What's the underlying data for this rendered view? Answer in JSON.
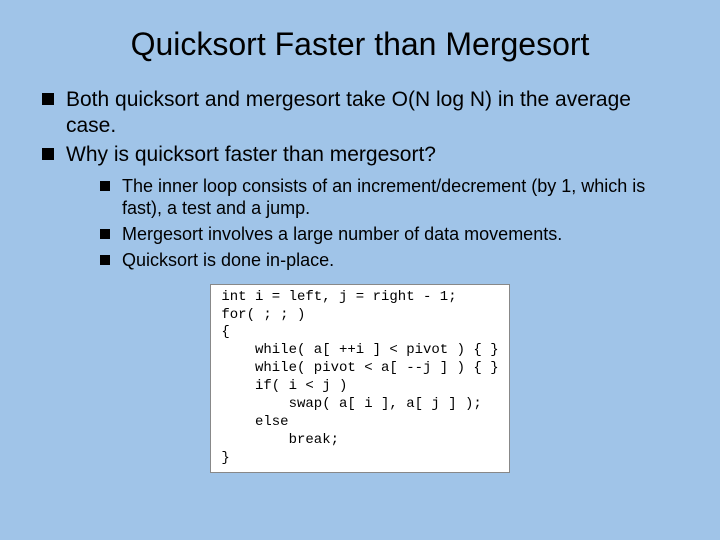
{
  "title": "Quicksort Faster than Mergesort",
  "bullets": {
    "b1": "Both quicksort and mergesort take O(N log N) in the average case.",
    "b2": "Why is quicksort faster than mergesort?"
  },
  "subbullets": {
    "s1": "The inner loop consists of an increment/decrement (by 1, which is fast), a test and a jump.",
    "s2": "Mergesort involves a large number of data movements.",
    "s3": "Quicksort is done in-place."
  },
  "code": "int i = left, j = right - 1;\nfor( ; ; )\n{\n    while( a[ ++i ] < pivot ) { }\n    while( pivot < a[ --j ] ) { }\n    if( i < j )\n        swap( a[ i ], a[ j ] );\n    else\n        break;\n}"
}
